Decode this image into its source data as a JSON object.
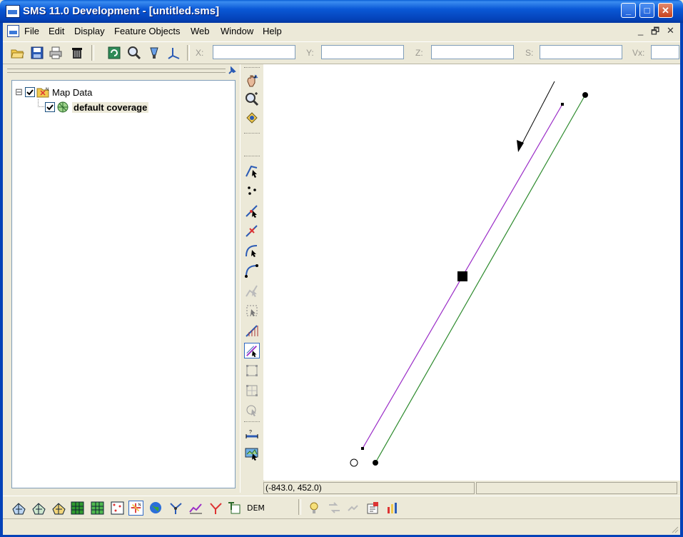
{
  "window": {
    "title": "SMS 11.0 Development - [untitled.sms]"
  },
  "menu": [
    "File",
    "Edit",
    "Display",
    "Feature Objects",
    "Web",
    "Window",
    "Help"
  ],
  "mdi_controls": {
    "minimize": "_",
    "restore": "🗗",
    "close": "✕"
  },
  "title_controls": {
    "minimize": "_",
    "maximize": "□",
    "close": "✕"
  },
  "coords": {
    "x_label": "X:",
    "y_label": "Y:",
    "z_label": "Z:",
    "s_label": "S:",
    "vx_label": "Vx:"
  },
  "tree": {
    "root_label": "Map Data",
    "child_label": "default coverage",
    "expander": "⊟"
  },
  "status": {
    "cursor_coords": "(-843.0, 452.0)"
  },
  "bottom_dem_label": "DEM",
  "colors": {
    "purple_arc": "#9A2CC7",
    "green_arc": "#2C8A2C",
    "titlebar": "#0A58D6"
  }
}
